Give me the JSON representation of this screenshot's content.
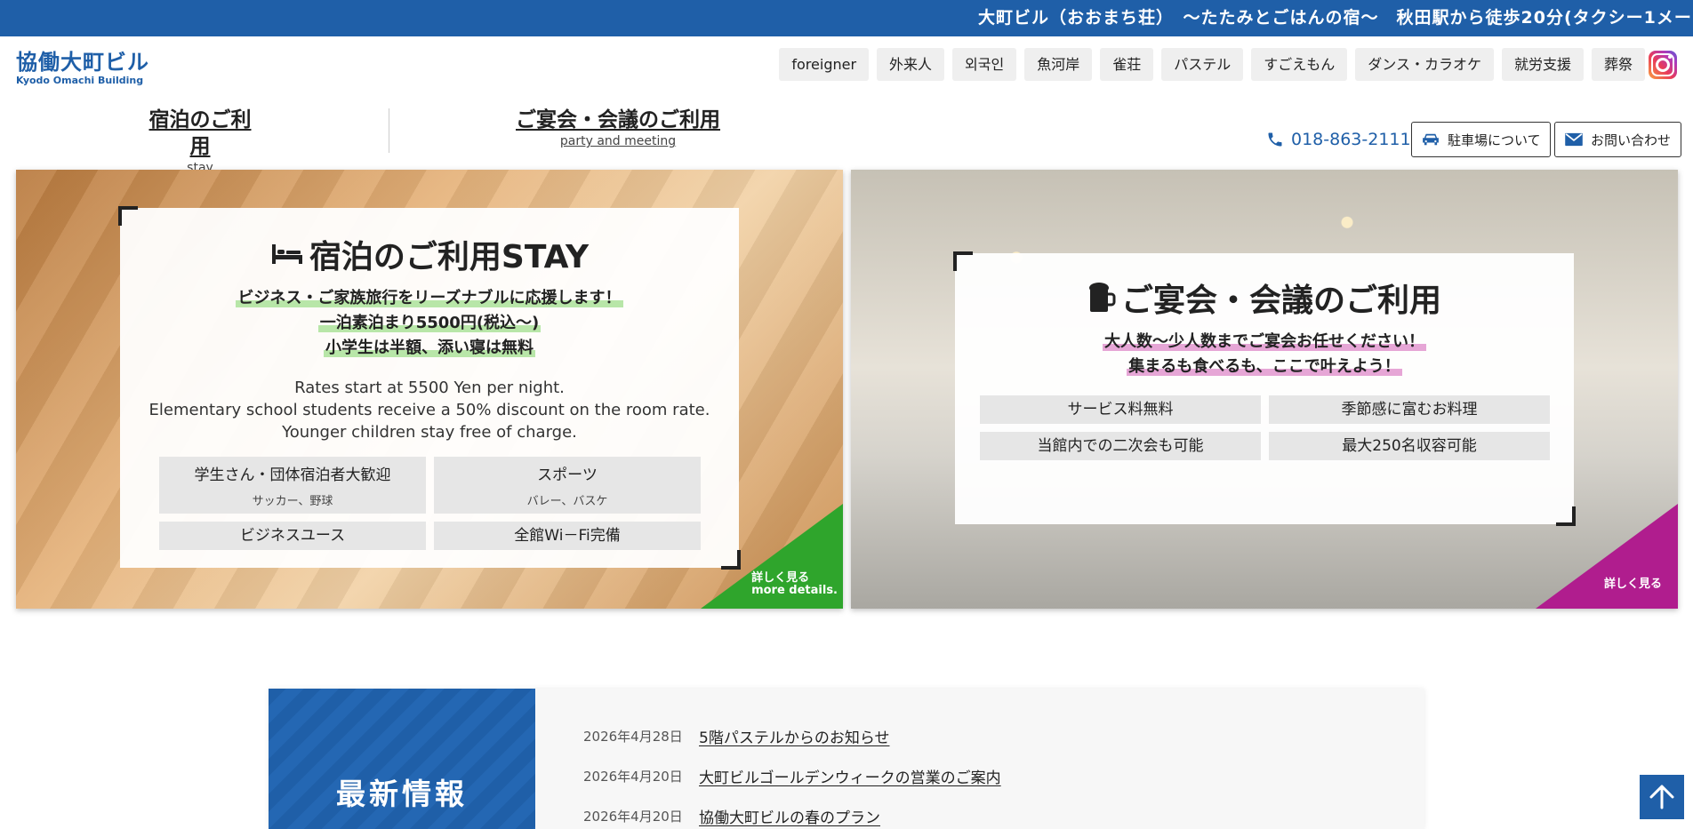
{
  "banner": {
    "text": "大町ビル（おおまち荘）　〜たたみとごはんの宿〜　秋田駅から徒歩20分(タクシー1メー"
  },
  "logo": {
    "jp": "協働大町ビル",
    "en": "Kyodo Omachi Building"
  },
  "langnav": [
    "foreigner",
    "外来人",
    "외국인",
    "魚河岸",
    "雀荘",
    "パステル",
    "すごえもん",
    "ダンス・カラオケ",
    "就労支援",
    "葬祭"
  ],
  "mainnav": {
    "stay": {
      "jp": "宿泊のご利用",
      "en": "stay"
    },
    "party": {
      "jp": "ご宴会・会議のご利用",
      "en": "party and meeting"
    }
  },
  "contact": {
    "phone": "018-863-2111",
    "parking": "駐車場について",
    "inquiry": "お問い合わせ"
  },
  "stay_card": {
    "title": "宿泊のご利用STAY",
    "highlights": [
      "ビジネス・ご家族旅行をリーズナブルに応援します！",
      "一泊素泊まり5500円(税込〜)",
      "小学生は半額、添い寝は無料"
    ],
    "english": [
      "Rates start at 5500 Yen per night.",
      "Elementary school students receive a 50% discount on the room rate.",
      "Younger children stay free of charge."
    ],
    "features": [
      {
        "main": "学生さん・団体宿泊者大歓迎",
        "sub": "サッカー、野球"
      },
      {
        "main": "スポーツ",
        "sub": "バレー、バスケ"
      },
      {
        "main": "ビジネスユース",
        "sub": ""
      },
      {
        "main": "全館Wi－Fi完備",
        "sub": ""
      }
    ],
    "more_jp": "詳しく見る",
    "more_en": "more details.",
    "accent": "#2fa52c"
  },
  "party_card": {
    "title": "ご宴会・会議のご利用",
    "highlights": [
      "大人数〜少人数までご宴会お任せください！",
      "集まるも食べるも、ここで叶えよう！"
    ],
    "features": [
      "サービス料無料",
      "季節感に富むお料理",
      "当館内での二次会も可能",
      "最大250名収容可能"
    ],
    "more_jp": "詳しく見る",
    "accent": "#b01d8e"
  },
  "news": {
    "title": "最新情報",
    "items": [
      {
        "date": "2026年4月28日",
        "title": "5階パステルからのお知らせ"
      },
      {
        "date": "2026年4月20日",
        "title": "大町ビルゴールデンウィークの営業のご案内"
      },
      {
        "date": "2026年4月20日",
        "title": "協働大町ビルの春のプラン"
      }
    ]
  },
  "colors": {
    "brand": "#1f5fa8",
    "stay_accent": "#2fa52c",
    "party_accent": "#b01d8e"
  },
  "icons": {
    "instagram": "instagram-icon",
    "phone": "phone-icon",
    "car": "car-icon",
    "mail": "mail-icon",
    "bed": "bed-icon",
    "beer": "beer-icon",
    "arrow_up": "arrow-up-icon"
  }
}
